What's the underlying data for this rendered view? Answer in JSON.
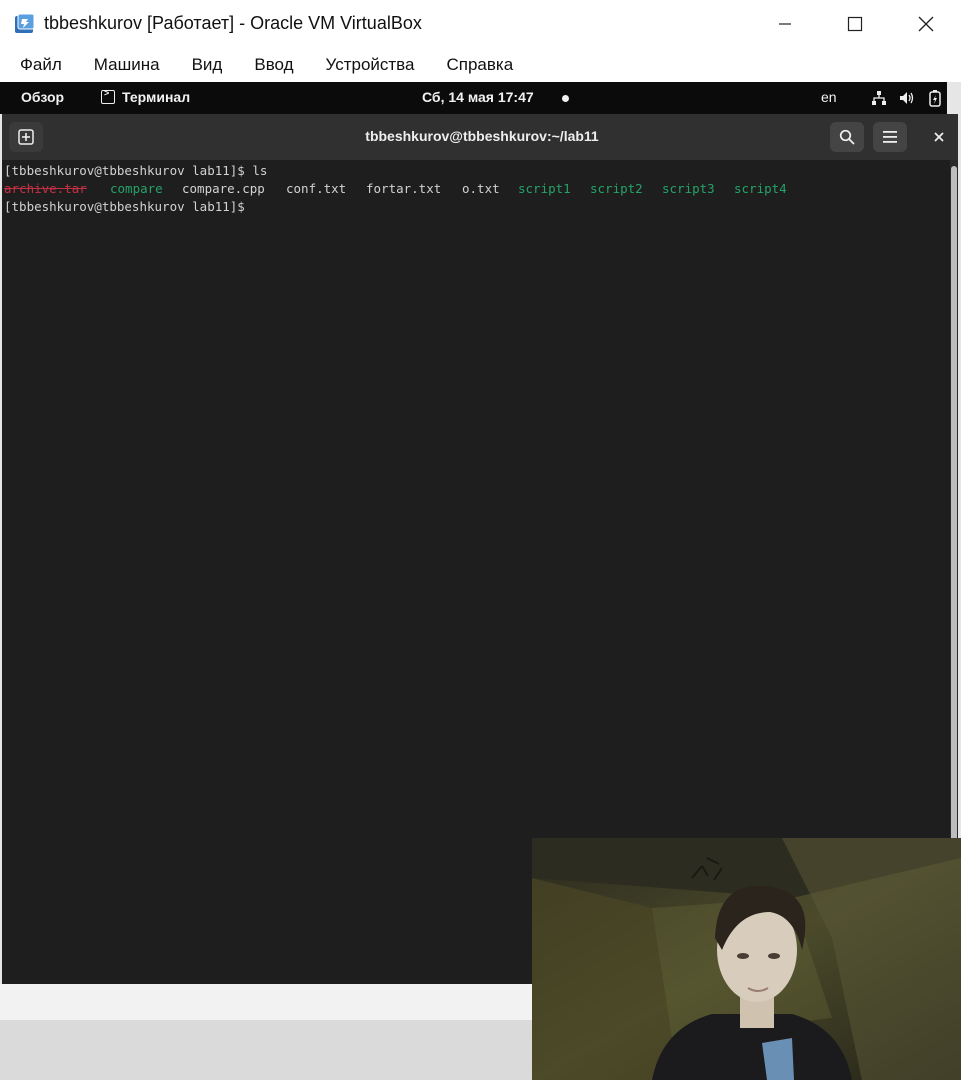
{
  "window": {
    "title": "tbbeshkurov [Работает] - Oracle VM VirtualBox",
    "icon": "virtualbox-icon"
  },
  "menu": [
    "Файл",
    "Машина",
    "Вид",
    "Ввод",
    "Устройства",
    "Справка"
  ],
  "gnome_bar": {
    "overview": "Обзор",
    "app": "Терминал",
    "clock": "Сб, 14 мая  17:47",
    "lang": "en",
    "status_icons": [
      "network-icon",
      "volume-icon",
      "battery-icon"
    ]
  },
  "terminal": {
    "title": "tbbeshkurov@tbbeshkurov:~/lab11",
    "lines": [
      {
        "prompt": "[tbbeshkurov@tbbeshkurov lab11]$ ",
        "command": "ls"
      },
      {
        "prompt": "[tbbeshkurov@tbbeshkurov lab11]$ ",
        "command": ""
      }
    ],
    "files": [
      {
        "name": "archive.tar",
        "kind": "red"
      },
      {
        "name": "compare",
        "kind": "green"
      },
      {
        "name": "compare.cpp",
        "kind": "plain"
      },
      {
        "name": "conf.txt",
        "kind": "plain"
      },
      {
        "name": "fortar.txt",
        "kind": "plain"
      },
      {
        "name": "o.txt",
        "kind": "plain"
      },
      {
        "name": "script1",
        "kind": "green"
      },
      {
        "name": "script2",
        "kind": "green"
      },
      {
        "name": "script3",
        "kind": "green"
      },
      {
        "name": "script4",
        "kind": "green"
      }
    ],
    "colors": {
      "executable": "#26a269",
      "archive": "#e0344a",
      "text": "#d2d2d2"
    }
  }
}
